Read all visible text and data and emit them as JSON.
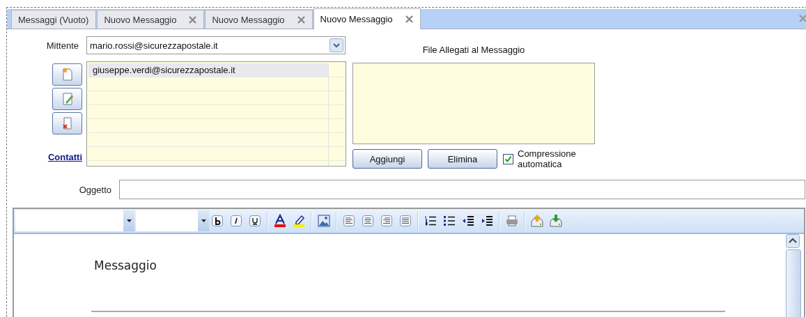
{
  "tabs": [
    {
      "label": "Messaggi (Vuoto)",
      "selected": false,
      "closable": false
    },
    {
      "label": "Nuovo Messaggio",
      "selected": false,
      "closable": true
    },
    {
      "label": "Nuovo Messaggio",
      "selected": false,
      "closable": true
    },
    {
      "label": "Nuovo Messaggio",
      "selected": true,
      "closable": true
    }
  ],
  "sender": {
    "label": "Mittente",
    "value": "mario.rossi@sicurezzapostale.it"
  },
  "recipients": {
    "link": "Contatti",
    "rows": [
      {
        "address": "giuseppe.verdi@sicurezzapostale.it",
        "selected": true
      }
    ]
  },
  "attachments": {
    "title": "File Allegati al Messaggio",
    "buttons": [
      "Aggiungi",
      "Elimina"
    ],
    "compression": {
      "label": "Compressione automatica",
      "checked": true
    }
  },
  "subject": {
    "label": "Oggetto"
  },
  "editor": {
    "body": "Messaggio"
  }
}
